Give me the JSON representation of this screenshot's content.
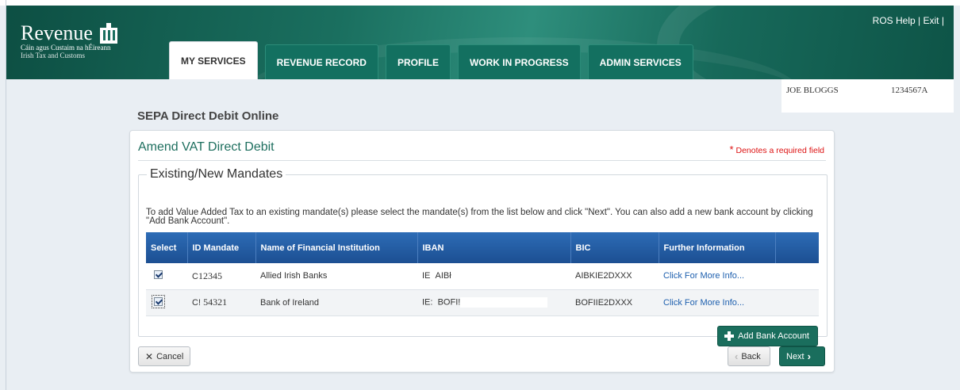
{
  "header": {
    "logo": {
      "word": "Revenue",
      "sub1": "Cáin agus Custaim na hÉireann",
      "sub2": "Irish Tax and Customs"
    },
    "links": {
      "help": "ROS Help",
      "sep": "|",
      "exit": "Exit",
      "trail": "|"
    },
    "tabs": [
      {
        "label": "MY SERVICES",
        "active": true
      },
      {
        "label": "REVENUE RECORD"
      },
      {
        "label": "PROFILE"
      },
      {
        "label": "WORK IN PROGRESS"
      },
      {
        "label": "ADMIN SERVICES"
      }
    ]
  },
  "user": {
    "name": "JOE BLOGGS",
    "id": "1234567A"
  },
  "section_title": "SEPA Direct Debit Online",
  "panel": {
    "title": "Amend VAT Direct Debit",
    "required_star": "*",
    "required_note": "Denotes a required field",
    "fieldset_legend": "Existing/New Mandates",
    "intro": "To add Value Added Tax to an existing mandate(s) please select the mandate(s) from the list below and click \"Next\". You can also add a new bank account by clicking \"Add Bank Account\".",
    "table": {
      "headers": [
        "Select",
        "ID Mandate",
        "Name of Financial Institution",
        "IBAN",
        "BIC",
        "Further Information"
      ],
      "rows": [
        {
          "selected": true,
          "id_prefix": "C",
          "id": "12345",
          "institution": "Allied Irish Banks",
          "iban_a": "IE",
          "iban_b": "AIBł",
          "bic": "AIBKIE2DXXX",
          "info": "Click For More Info..."
        },
        {
          "selected": true,
          "id_prefix": "C!",
          "id": "54321",
          "institution": "Bank of Ireland",
          "iban_a": "IE:",
          "iban_b": "BOFI!",
          "bic": "BOFIIE2DXXX",
          "info": "Click For More Info..."
        }
      ]
    },
    "add_bank_label": "Add Bank Account",
    "cancel_label": "Cancel",
    "back_label": "Back",
    "next_label": "Next"
  }
}
